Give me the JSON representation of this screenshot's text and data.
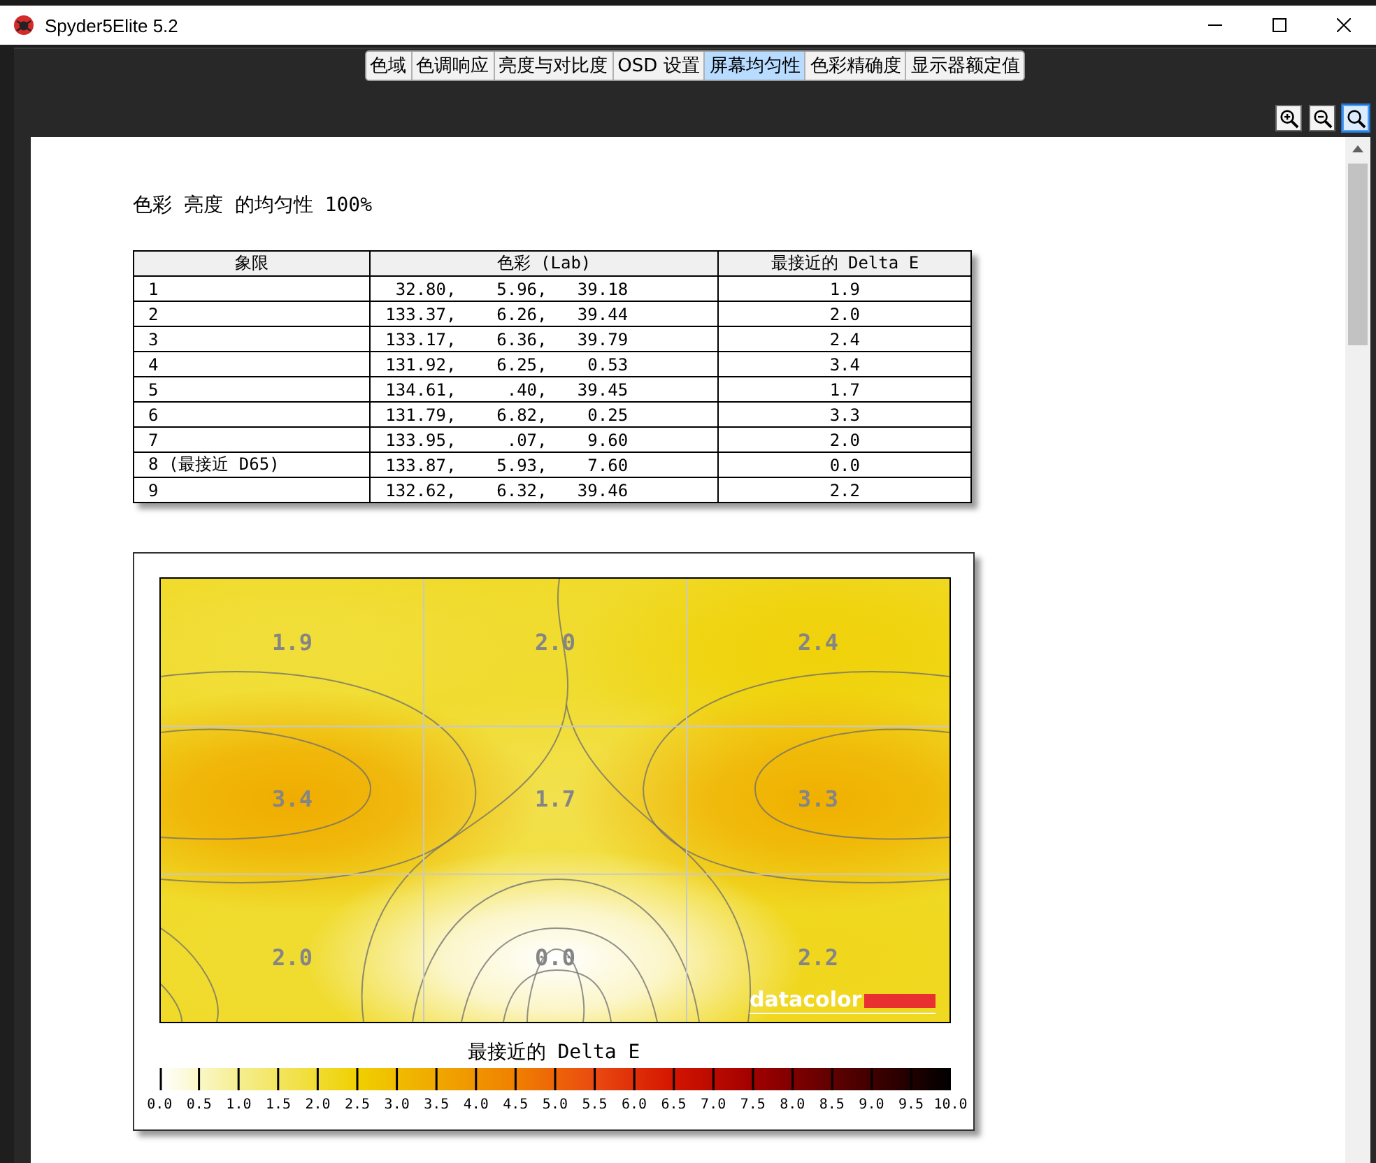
{
  "window": {
    "title": "Spyder5Elite 5.2"
  },
  "tabs": [
    {
      "label": "色域",
      "selected": false
    },
    {
      "label": "色调响应",
      "selected": false
    },
    {
      "label": "亮度与对比度",
      "selected": false
    },
    {
      "label": "OSD 设置",
      "selected": false
    },
    {
      "label": "屏幕均匀性",
      "selected": true
    },
    {
      "label": "色彩精确度",
      "selected": false
    },
    {
      "label": "显示器额定值",
      "selected": false
    }
  ],
  "toolbar": [
    {
      "kind": "zoom-in",
      "selected": false
    },
    {
      "kind": "zoom-out",
      "selected": false
    },
    {
      "kind": "fit",
      "selected": true
    }
  ],
  "report": {
    "title": "色彩 亮度 的均匀性 100%",
    "table": {
      "columns": [
        "象限",
        "色彩 (Lab)",
        "最接近的 Delta E"
      ],
      "rows": [
        {
          "quadrant": "1",
          "lab": " 32.80,    5.96,   39.18",
          "delta_e": "1.9"
        },
        {
          "quadrant": "2",
          "lab": "133.37,    6.26,   39.44",
          "delta_e": "2.0"
        },
        {
          "quadrant": "3",
          "lab": "133.17,    6.36,   39.79",
          "delta_e": "2.4"
        },
        {
          "quadrant": "4",
          "lab": "131.92,    6.25,    0.53",
          "delta_e": "3.4"
        },
        {
          "quadrant": "5",
          "lab": "134.61,     .40,   39.45",
          "delta_e": "1.7"
        },
        {
          "quadrant": "6",
          "lab": "131.79,    6.82,    0.25",
          "delta_e": "3.3"
        },
        {
          "quadrant": "7",
          "lab": "133.95,     .07,    9.60",
          "delta_e": "2.0"
        },
        {
          "quadrant": "8 (最接近 D65)",
          "lab": "133.87,    5.93,    7.60",
          "delta_e": "0.0"
        },
        {
          "quadrant": "9",
          "lab": "132.62,    6.32,   39.46",
          "delta_e": "2.2"
        }
      ]
    },
    "map": {
      "cells": [
        "1.9",
        "2.0",
        "2.4",
        "3.4",
        "1.7",
        "3.3",
        "2.0",
        "0.0",
        "2.2"
      ],
      "logo": "datacolor",
      "scale": {
        "title": "最接近的 Delta E",
        "ticks": [
          "0.0",
          "0.5",
          "1.0",
          "1.5",
          "2.0",
          "2.5",
          "3.0",
          "3.5",
          "4.0",
          "4.5",
          "5.0",
          "5.5",
          "6.0",
          "6.5",
          "7.0",
          "7.5",
          "8.0",
          "8.5",
          "9.0",
          "9.5",
          "10.0"
        ]
      }
    }
  }
}
